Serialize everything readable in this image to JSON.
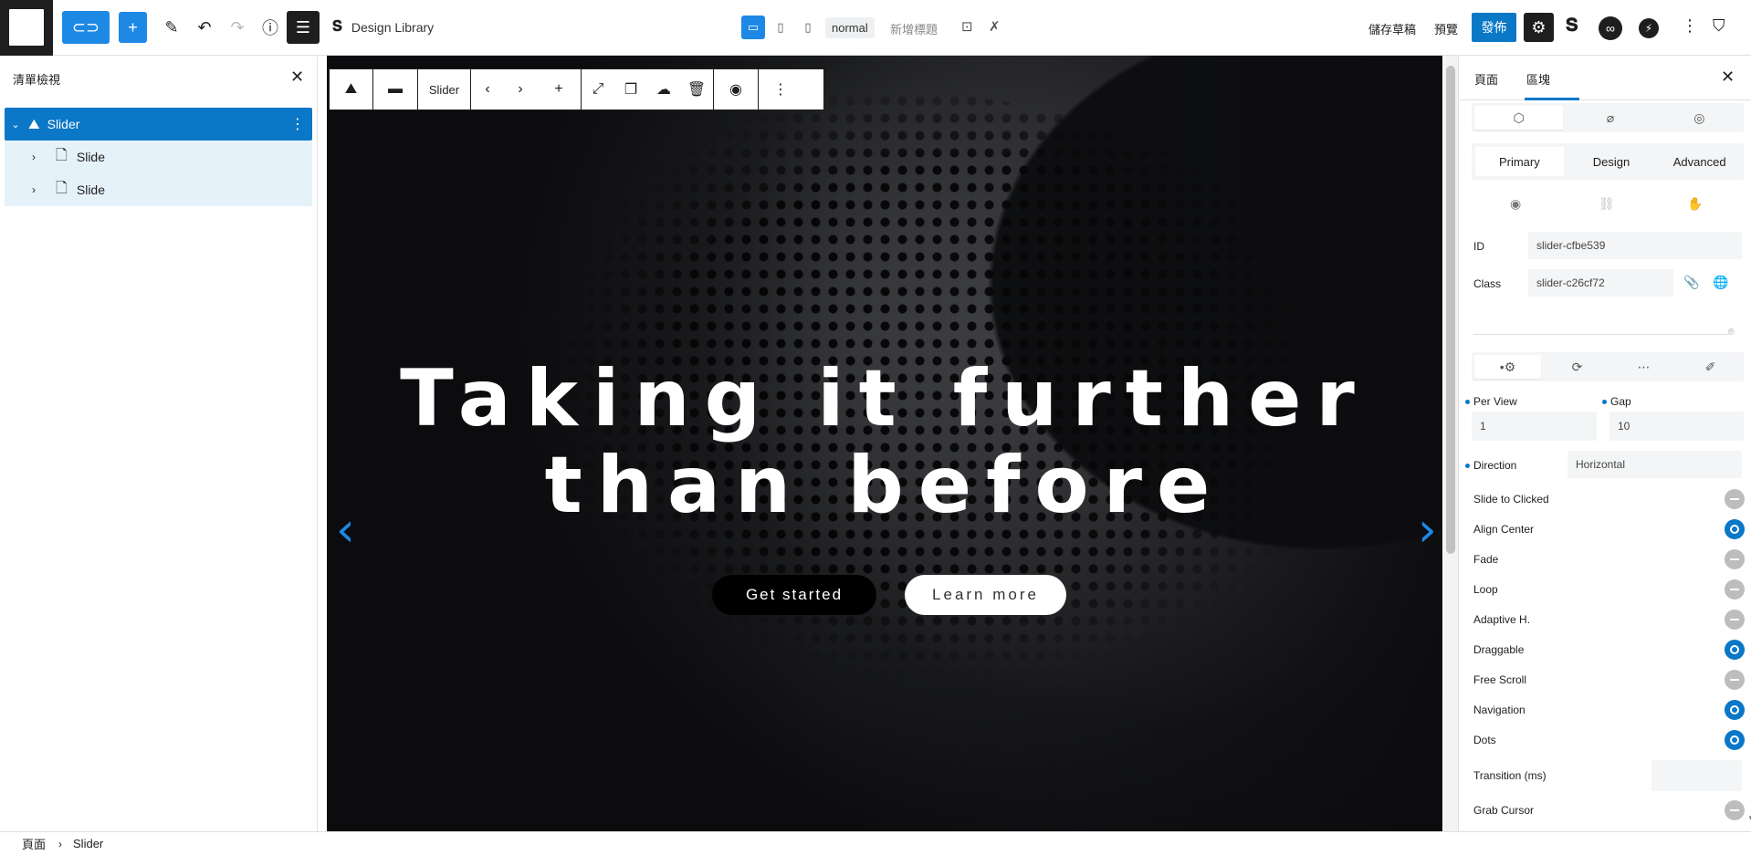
{
  "topbar": {
    "library_label": "Design Library",
    "view_mode": "normal",
    "add_template": "新增標題",
    "save_draft": "儲存草稿",
    "preview": "預覽",
    "publish": "發佈"
  },
  "left_panel": {
    "title": "清單檢視",
    "tree": [
      {
        "label": "Slider",
        "selected": true
      },
      {
        "label": "Slide"
      },
      {
        "label": "Slide"
      }
    ]
  },
  "block_toolbar": {
    "block_name": "Slider"
  },
  "hero": {
    "line1": "Taking it further",
    "line2": "than before",
    "primary_button": "Get started",
    "secondary_button": "Learn more"
  },
  "right_panel": {
    "tabs": [
      "頁面",
      "區塊"
    ],
    "active_tab": "區塊",
    "subtabs": [
      "Primary",
      "Design",
      "Advanced"
    ],
    "id_label": "ID",
    "id_value": "slider-cfbe539",
    "class_label": "Class",
    "class_value": "slider-c26cf72",
    "per_view_label": "Per View",
    "per_view_value": "1",
    "gap_label": "Gap",
    "gap_value": "10",
    "direction_label": "Direction",
    "direction_value": "Horizontal",
    "transition_label": "Transition (ms)",
    "toggles": [
      {
        "label": "Slide to Clicked",
        "on": false
      },
      {
        "label": "Align Center",
        "on": true
      },
      {
        "label": "Fade",
        "on": false
      },
      {
        "label": "Loop",
        "on": false
      },
      {
        "label": "Adaptive H.",
        "on": false
      },
      {
        "label": "Draggable",
        "on": true
      },
      {
        "label": "Free Scroll",
        "on": false
      },
      {
        "label": "Navigation",
        "on": true
      },
      {
        "label": "Dots",
        "on": true
      }
    ],
    "grab_cursor_label": "Grab Cursor"
  },
  "breadcrumb": {
    "root": "頁面",
    "current": "Slider"
  },
  "colors": {
    "accent": "#0a77c7",
    "toolbar_blue": "#1e88e5",
    "dark": "#1e1e1e"
  }
}
